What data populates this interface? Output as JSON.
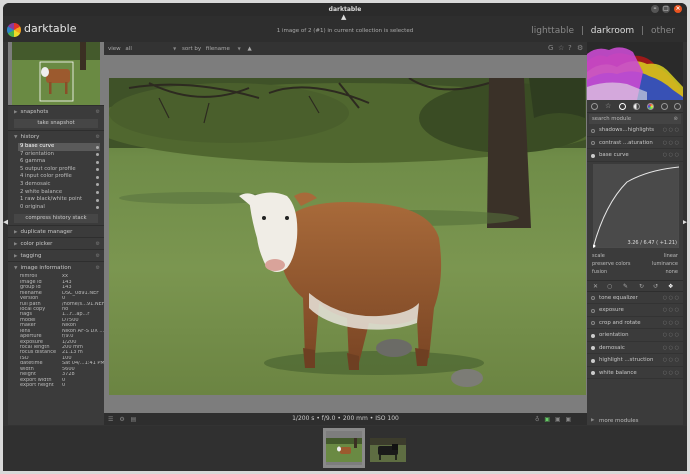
{
  "window": {
    "title": "darktable"
  },
  "header": {
    "logo_text": "darktable",
    "collection_info": "1 image of 2 (#1) in current collection is selected",
    "views": [
      "lighttable",
      "darkroom",
      "other"
    ],
    "active_view": "darkroom",
    "separator": "|"
  },
  "left": {
    "snapshots_label": "snapshots",
    "take_snapshot_label": "take snapshot",
    "history_label": "history",
    "history_items": [
      "9 base curve",
      "7 orientation",
      "6 gamma",
      "5 output color profile",
      "4 input color profile",
      "3 demosaic",
      "2 white balance",
      "1 raw black/white point",
      "0 original"
    ],
    "compress_label": "compress history stack",
    "duplicate_label": "duplicate manager",
    "color_picker_label": "color picker",
    "tagging_label": "tagging",
    "image_info_label": "image information",
    "info": [
      {
        "k": "filmroll",
        "v": "xx"
      },
      {
        "k": "image id",
        "v": "143"
      },
      {
        "k": "group id",
        "v": "143"
      },
      {
        "k": "filename",
        "v": "DSC_0891.NEF"
      },
      {
        "k": "version",
        "v": "0"
      },
      {
        "k": "full path",
        "v": "/home/s...91.NEF"
      },
      {
        "k": "local copy",
        "v": "no"
      },
      {
        "k": "flags",
        "v": "1...r...ap...r"
      },
      {
        "k": "model",
        "v": "D7500"
      },
      {
        "k": "maker",
        "v": "Nikon"
      },
      {
        "k": "lens",
        "v": "Nikon AF-S DX ..."
      },
      {
        "k": "aperture",
        "v": "f/9.0"
      },
      {
        "k": "exposure",
        "v": "1/200"
      },
      {
        "k": "focal length",
        "v": "200 mm"
      },
      {
        "k": "focus distance",
        "v": "21.13 m"
      },
      {
        "k": "ISO",
        "v": "100"
      },
      {
        "k": "datetime",
        "v": "Sat 04/...1:41 PM"
      },
      {
        "k": "width",
        "v": "5600"
      },
      {
        "k": "height",
        "v": "3728"
      },
      {
        "k": "export width",
        "v": "0"
      },
      {
        "k": "export height",
        "v": "0"
      }
    ]
  },
  "center": {
    "view_label": "view",
    "view_value": "all",
    "sort_label": "sort by",
    "sort_value": "filename",
    "exif_line": "1/200 s • f/9.0 • 200 mm • ISO 100"
  },
  "right": {
    "search_placeholder": "search module",
    "modules_top": [
      {
        "name": "shadows...highlights",
        "on": false
      },
      {
        "name": "contrast ...aturation",
        "on": false
      },
      {
        "name": "base curve",
        "on": true
      }
    ],
    "curve_readout": "3.26 / 6.47 ( +1.21)",
    "curve_rows": [
      {
        "k": "scale",
        "v": "linear"
      },
      {
        "k": "preserve colors",
        "v": "luminance"
      },
      {
        "k": "fusion",
        "v": "none"
      }
    ],
    "modules_bottom": [
      {
        "name": "tone equalizer",
        "on": false
      },
      {
        "name": "exposure",
        "on": false
      },
      {
        "name": "crop and rotate",
        "on": false
      },
      {
        "name": "orientation",
        "on": true
      },
      {
        "name": "demosaic",
        "on": true
      },
      {
        "name": "highlight ...struction",
        "on": true
      },
      {
        "name": "white balance",
        "on": true
      }
    ],
    "more_modules_label": "more modules"
  },
  "colors": {
    "accent": "#ffffff",
    "panel": "#3b3b3b",
    "background": "#333333"
  }
}
